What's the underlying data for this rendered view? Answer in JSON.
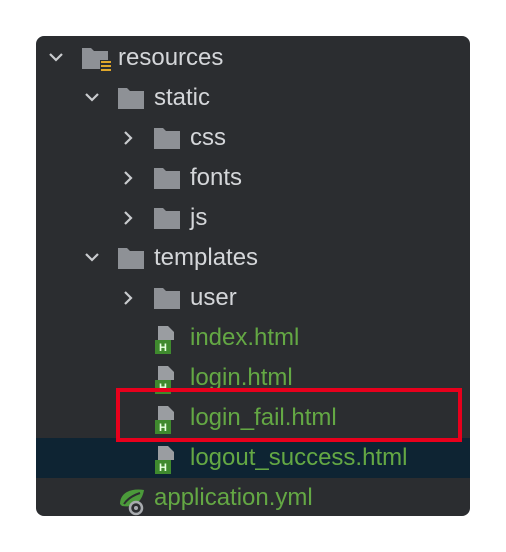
{
  "tree": {
    "resources": "resources",
    "static": "static",
    "css": "css",
    "fonts": "fonts",
    "js": "js",
    "templates": "templates",
    "user": "user",
    "files": [
      "index.html",
      "login.html",
      "login_fail.html",
      "logout_success.html"
    ],
    "application": "application.yml"
  },
  "icons": {
    "folder": "folder-icon",
    "resources_folder": "resources-folder-icon",
    "html_file": "html-file-icon",
    "yaml_file": "spring-yaml-icon"
  },
  "colors": {
    "panel_bg": "#2b2d30",
    "folder_text": "#d4d6d9",
    "file_text": "#64a844",
    "selected_row": "#0e2433",
    "highlight": "#e8001c"
  }
}
